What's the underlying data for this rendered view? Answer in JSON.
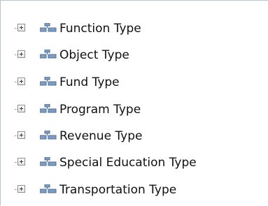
{
  "tree": {
    "items": [
      {
        "label": "Function Type",
        "icon": "hierarchy-icon",
        "expander": "plus"
      },
      {
        "label": "Object Type",
        "icon": "hierarchy-icon",
        "expander": "plus"
      },
      {
        "label": "Fund Type",
        "icon": "hierarchy-icon",
        "expander": "plus"
      },
      {
        "label": "Program Type",
        "icon": "hierarchy-icon",
        "expander": "plus"
      },
      {
        "label": "Revenue Type",
        "icon": "hierarchy-icon",
        "expander": "plus"
      },
      {
        "label": "Special Education Type",
        "icon": "hierarchy-icon",
        "expander": "plus"
      },
      {
        "label": "Transportation Type",
        "icon": "hierarchy-icon",
        "expander": "plus"
      }
    ]
  }
}
